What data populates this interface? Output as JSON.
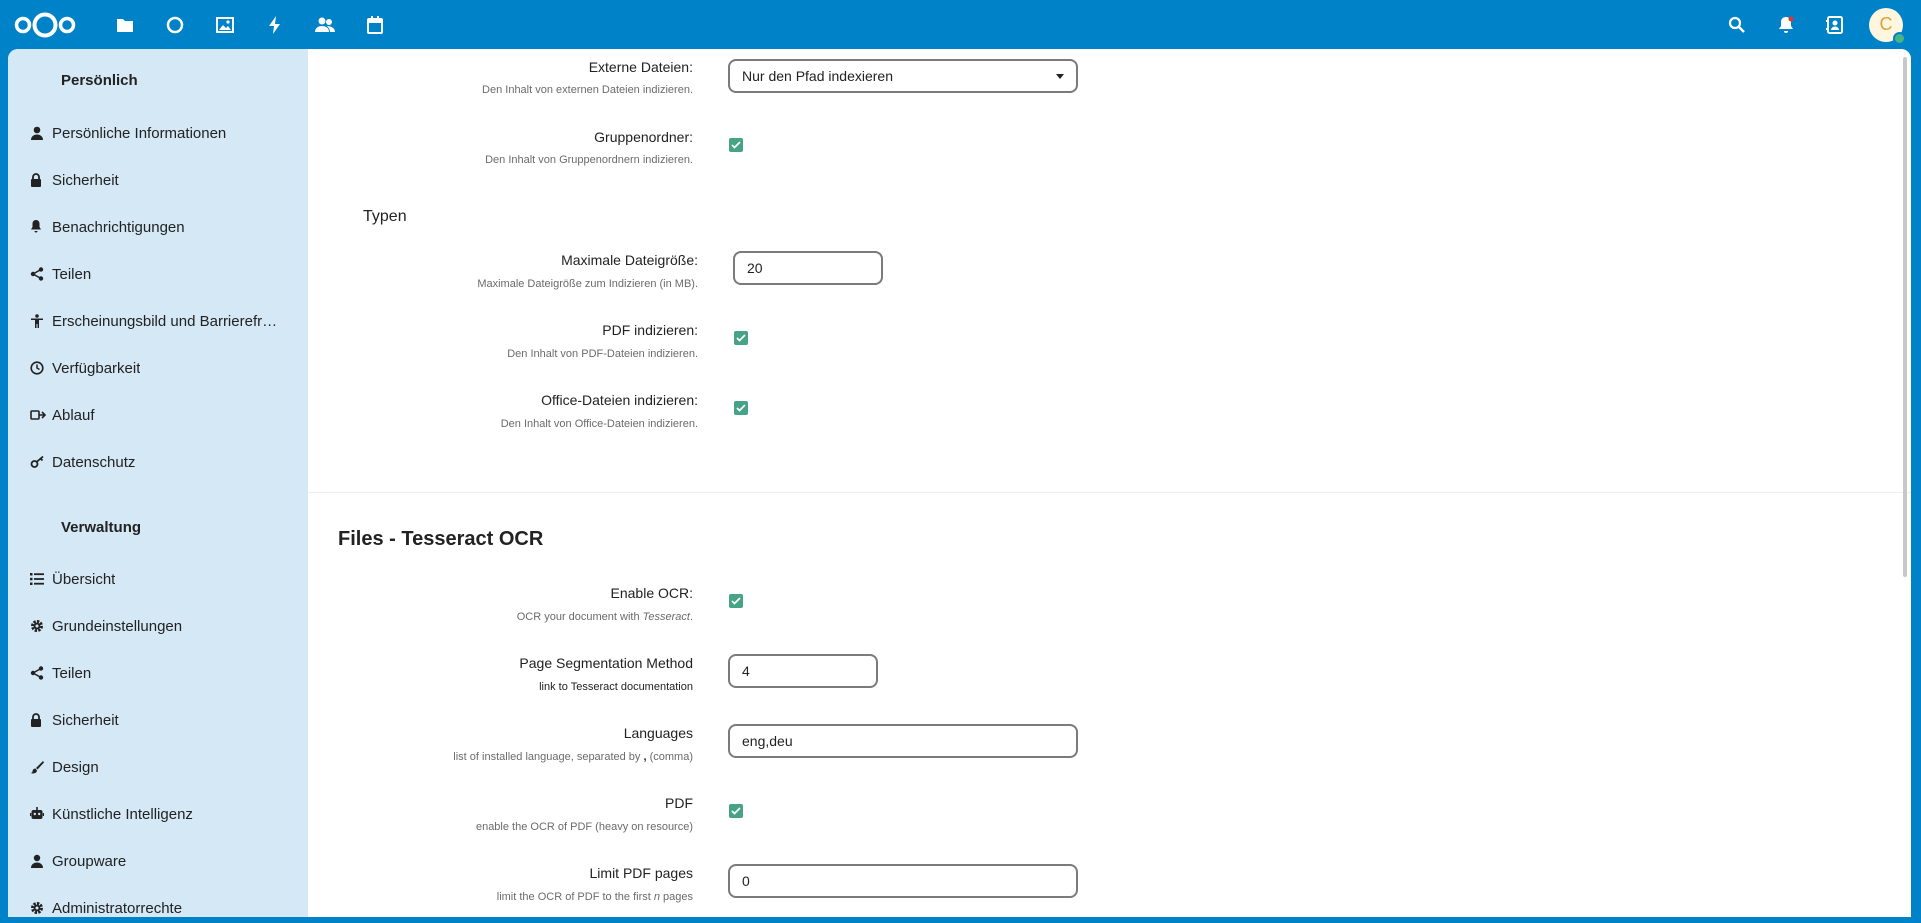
{
  "header": {
    "apps": [
      {
        "name": "files-icon"
      },
      {
        "name": "dashboard-icon"
      },
      {
        "name": "photos-icon"
      },
      {
        "name": "activity-icon"
      },
      {
        "name": "contacts-icon"
      },
      {
        "name": "calendar-icon"
      }
    ],
    "avatar_letter": "C"
  },
  "sidebar": {
    "personal_caption": "Persönlich",
    "personal_items": [
      {
        "label": "Persönliche Informationen"
      },
      {
        "label": "Sicherheit"
      },
      {
        "label": "Benachrichtigungen"
      },
      {
        "label": "Teilen"
      },
      {
        "label": "Erscheinungsbild und Barrierefreiheit"
      },
      {
        "label": "Verfügbarkeit"
      },
      {
        "label": "Ablauf"
      },
      {
        "label": "Datenschutz"
      }
    ],
    "admin_caption": "Verwaltung",
    "admin_items": [
      {
        "label": "Übersicht"
      },
      {
        "label": "Grundeinstellungen"
      },
      {
        "label": "Teilen"
      },
      {
        "label": "Sicherheit"
      },
      {
        "label": "Design"
      },
      {
        "label": "Künstliche Intelligenz"
      },
      {
        "label": "Groupware"
      },
      {
        "label": "Administratorrechte"
      }
    ]
  },
  "content": {
    "external_files": {
      "label": "Externe Dateien:",
      "hint": "Den Inhalt von externen Dateien indizieren.",
      "value": "Nur den Pfad indexieren"
    },
    "group_folders": {
      "label": "Gruppenordner:",
      "hint": "Den Inhalt von Gruppenordnern indizieren.",
      "checked": true
    },
    "types_heading": "Typen",
    "max_size": {
      "label": "Maximale Dateigröße:",
      "hint": "Maximale Dateigröße zum Indizieren (in MB).",
      "value": "20"
    },
    "pdf_index": {
      "label": "PDF indizieren:",
      "hint": "Den Inhalt von PDF-Dateien indizieren.",
      "checked": true
    },
    "office_index": {
      "label": "Office-Dateien indizieren:",
      "hint": "Den Inhalt von Office-Dateien indizieren.",
      "checked": true
    },
    "ocr_heading": "Files - Tesseract OCR",
    "enable_ocr": {
      "label": "Enable OCR:",
      "hint_prefix": "OCR your document with ",
      "hint_em": "Tesseract",
      "hint_suffix": ".",
      "checked": true
    },
    "psm": {
      "label": "Page Segmentation Method",
      "hint": "link to Tesseract documentation",
      "value": "4"
    },
    "languages": {
      "label": "Languages",
      "hint_prefix": "list of installed language, separated by ",
      "hint_bold": ",",
      "hint_suffix": " (comma)",
      "value": "eng,deu"
    },
    "pdf_ocr": {
      "label": "PDF",
      "hint": "enable the OCR of PDF (heavy on resource)",
      "checked": true
    },
    "limit_pdf": {
      "label": "Limit PDF pages",
      "hint_prefix": "limit the OCR of PDF to the first ",
      "hint_em": "n",
      "hint_suffix": " pages",
      "value": "0"
    }
  }
}
